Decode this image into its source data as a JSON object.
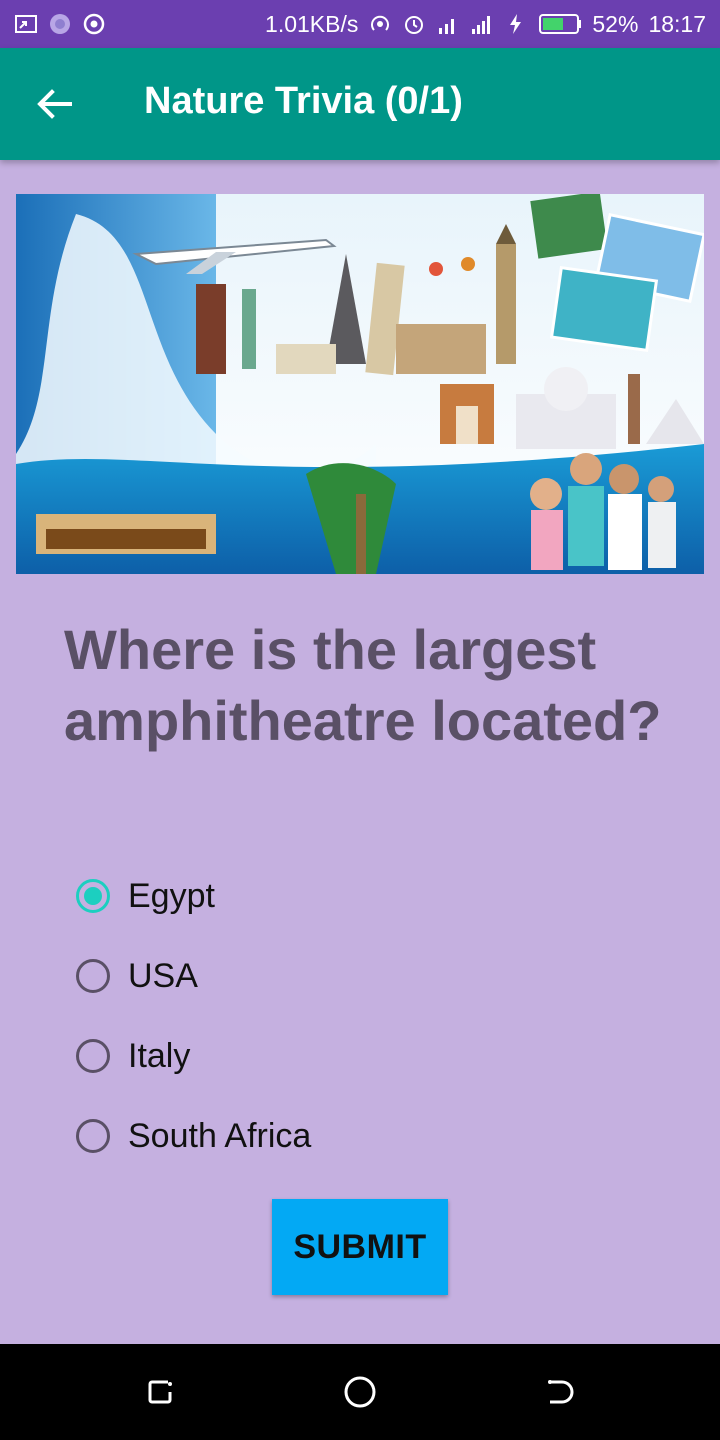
{
  "status_bar": {
    "network_speed": "1.01KB/s",
    "battery_percent": "52%",
    "time": "18:17",
    "left_icons": [
      "cast-icon",
      "app-icon",
      "sync-icon"
    ],
    "right_icons": [
      "hotspot-icon",
      "alarm-icon",
      "signal-icon",
      "signal-icon",
      "charging-icon",
      "battery-icon"
    ]
  },
  "toolbar": {
    "title": "Nature Trivia (0/1)",
    "back_icon": "arrow-back-icon"
  },
  "question": {
    "text": "Where is the largest amphitheatre located?"
  },
  "options": [
    {
      "label": "Egypt",
      "selected": true
    },
    {
      "label": "USA",
      "selected": false
    },
    {
      "label": "Italy",
      "selected": false
    },
    {
      "label": "South Africa",
      "selected": false
    }
  ],
  "submit": {
    "label": "SUBMIT"
  },
  "colors": {
    "status_bar": "#6b3fb0",
    "toolbar": "#009688",
    "background": "#c5b0e0",
    "accent": "#1ccfc0",
    "submit": "#03a9f4"
  }
}
